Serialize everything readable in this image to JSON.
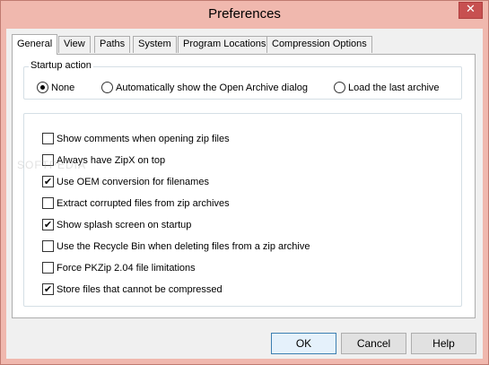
{
  "window": {
    "title": "Preferences",
    "close_glyph": "✕"
  },
  "tabs": [
    {
      "label": "General",
      "active": true
    },
    {
      "label": "View",
      "active": false
    },
    {
      "label": "Paths",
      "active": false
    },
    {
      "label": "System",
      "active": false
    },
    {
      "label": "Program Locations",
      "active": false
    },
    {
      "label": "Compression Options",
      "active": false
    }
  ],
  "startup": {
    "label": "Startup action",
    "options": [
      {
        "label": "None",
        "selected": true
      },
      {
        "label": "Automatically show the Open Archive dialog",
        "selected": false
      },
      {
        "label": "Load the last archive",
        "selected": false
      }
    ]
  },
  "options": [
    {
      "label": "Show comments when opening zip files",
      "checked": false
    },
    {
      "label": "Always have ZipX on top",
      "checked": false
    },
    {
      "label": "Use OEM conversion for filenames",
      "checked": true
    },
    {
      "label": "Extract corrupted files from zip archives",
      "checked": false
    },
    {
      "label": "Show splash screen on startup",
      "checked": true
    },
    {
      "label": "Use the Recycle Bin when deleting files from a zip archive",
      "checked": false
    },
    {
      "label": "Force PKZip 2.04 file limitations",
      "checked": false
    },
    {
      "label": "Store files that cannot be compressed",
      "checked": true
    }
  ],
  "buttons": {
    "ok": "OK",
    "cancel": "Cancel",
    "help": "Help"
  },
  "check_glyph": "✔",
  "watermark": "SOFTPEDIA"
}
